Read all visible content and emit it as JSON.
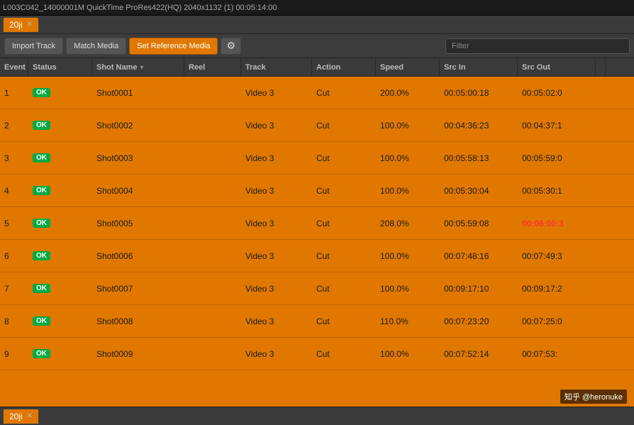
{
  "topbar": {
    "content": "L003C042_14000001M     QuickTime ProRes422(HQ)    2040x1132 (1)    00:05:14:00"
  },
  "tabs": [
    {
      "label": "20ji",
      "active": true,
      "closable": true
    }
  ],
  "toolbar": {
    "import_track": "Import Track",
    "match_media": "Match Media",
    "set_reference_media": "Set Reference Media",
    "filter_placeholder": "Filter"
  },
  "table": {
    "columns": [
      {
        "label": "Event",
        "sortable": false
      },
      {
        "label": "Status",
        "sortable": false
      },
      {
        "label": "Shot Name",
        "sortable": true
      },
      {
        "label": "Reel",
        "sortable": false
      },
      {
        "label": "Track",
        "sortable": false
      },
      {
        "label": "Action",
        "sortable": false
      },
      {
        "label": "Speed",
        "sortable": false
      },
      {
        "label": "Src In",
        "sortable": false
      },
      {
        "label": "Src Out",
        "sortable": false
      }
    ],
    "rows": [
      {
        "event": "1",
        "status": "OK",
        "shot_name": "Shot0001",
        "reel": "",
        "track": "Video 3",
        "action": "Cut",
        "speed": "200.0%",
        "src_in": "00:05:00:18",
        "src_out": "00:05:02:0",
        "src_out_red": false
      },
      {
        "event": "2",
        "status": "OK",
        "shot_name": "Shot0002",
        "reel": "",
        "track": "Video 3",
        "action": "Cut",
        "speed": "100.0%",
        "src_in": "00:04:36:23",
        "src_out": "00:04:37:1",
        "src_out_red": false
      },
      {
        "event": "3",
        "status": "OK",
        "shot_name": "Shot0003",
        "reel": "",
        "track": "Video 3",
        "action": "Cut",
        "speed": "100.0%",
        "src_in": "00:05:58:13",
        "src_out": "00:05:59:0",
        "src_out_red": false
      },
      {
        "event": "4",
        "status": "OK",
        "shot_name": "Shot0004",
        "reel": "",
        "track": "Video 3",
        "action": "Cut",
        "speed": "100.0%",
        "src_in": "00:05:30:04",
        "src_out": "00:05:30:1",
        "src_out_red": false
      },
      {
        "event": "5",
        "status": "OK",
        "shot_name": "Shot0005",
        "reel": "",
        "track": "Video 3",
        "action": "Cut",
        "speed": "208.0%",
        "src_in": "00:05:59:08",
        "src_out": "00:06:00:3",
        "src_out_red": true
      },
      {
        "event": "6",
        "status": "OK",
        "shot_name": "Shot0006",
        "reel": "",
        "track": "Video 3",
        "action": "Cut",
        "speed": "100.0%",
        "src_in": "00:07:48:16",
        "src_out": "00:07:49:3",
        "src_out_red": false
      },
      {
        "event": "7",
        "status": "OK",
        "shot_name": "Shot0007",
        "reel": "",
        "track": "Video 3",
        "action": "Cut",
        "speed": "100.0%",
        "src_in": "00:09:17:10",
        "src_out": "00:09:17:2",
        "src_out_red": false
      },
      {
        "event": "8",
        "status": "OK",
        "shot_name": "Shot0008",
        "reel": "",
        "track": "Video 3",
        "action": "Cut",
        "speed": "110.0%",
        "src_in": "00:07:23:20",
        "src_out": "00:07:25:0",
        "src_out_red": false
      },
      {
        "event": "9",
        "status": "OK",
        "shot_name": "Shot0009",
        "reel": "",
        "track": "Video 3",
        "action": "Cut",
        "speed": "100.0%",
        "src_in": "00:07:52:14",
        "src_out": "00:07:53:",
        "src_out_red": false
      }
    ]
  },
  "bottom_tabs": [
    {
      "label": "20ji",
      "active": true,
      "closable": true
    }
  ],
  "watermark": "知乎 @heronuke"
}
